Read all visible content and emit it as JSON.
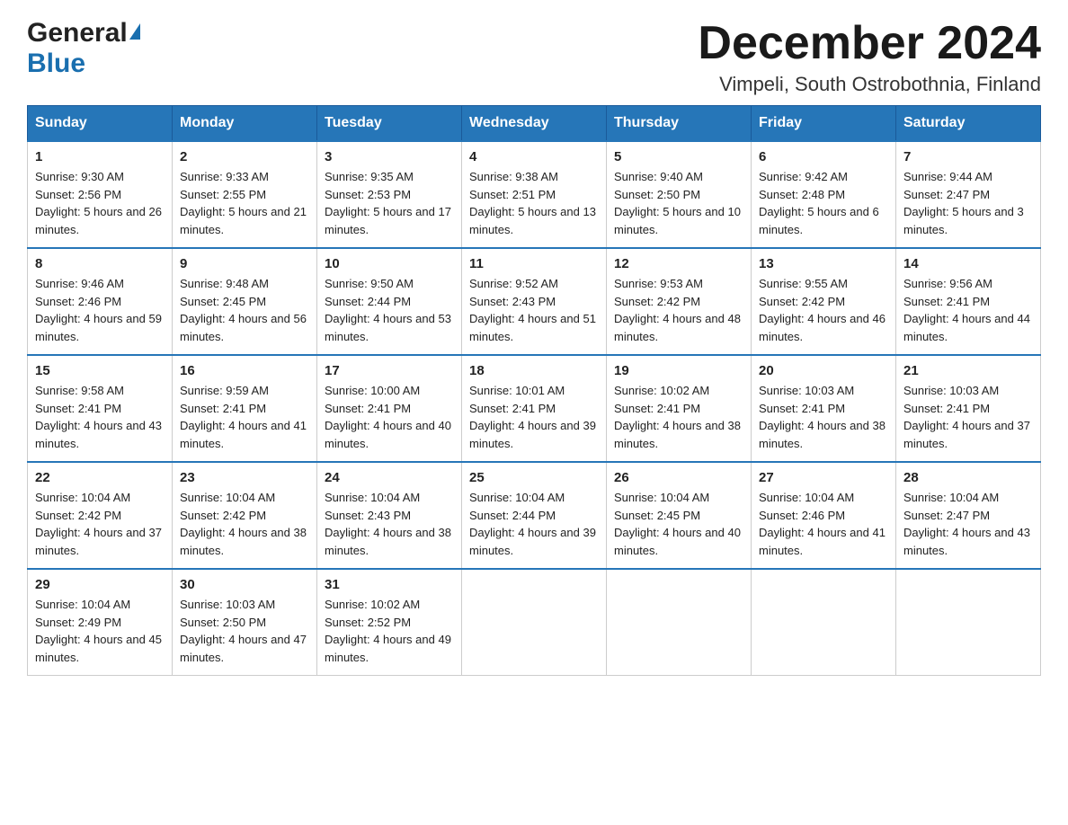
{
  "header": {
    "logo_general": "General",
    "logo_blue": "Blue",
    "month_title": "December 2024",
    "location": "Vimpeli, South Ostrobothnia, Finland"
  },
  "days_of_week": [
    "Sunday",
    "Monday",
    "Tuesday",
    "Wednesday",
    "Thursday",
    "Friday",
    "Saturday"
  ],
  "weeks": [
    [
      {
        "day": "1",
        "sunrise": "9:30 AM",
        "sunset": "2:56 PM",
        "daylight": "5 hours and 26 minutes."
      },
      {
        "day": "2",
        "sunrise": "9:33 AM",
        "sunset": "2:55 PM",
        "daylight": "5 hours and 21 minutes."
      },
      {
        "day": "3",
        "sunrise": "9:35 AM",
        "sunset": "2:53 PM",
        "daylight": "5 hours and 17 minutes."
      },
      {
        "day": "4",
        "sunrise": "9:38 AM",
        "sunset": "2:51 PM",
        "daylight": "5 hours and 13 minutes."
      },
      {
        "day": "5",
        "sunrise": "9:40 AM",
        "sunset": "2:50 PM",
        "daylight": "5 hours and 10 minutes."
      },
      {
        "day": "6",
        "sunrise": "9:42 AM",
        "sunset": "2:48 PM",
        "daylight": "5 hours and 6 minutes."
      },
      {
        "day": "7",
        "sunrise": "9:44 AM",
        "sunset": "2:47 PM",
        "daylight": "5 hours and 3 minutes."
      }
    ],
    [
      {
        "day": "8",
        "sunrise": "9:46 AM",
        "sunset": "2:46 PM",
        "daylight": "4 hours and 59 minutes."
      },
      {
        "day": "9",
        "sunrise": "9:48 AM",
        "sunset": "2:45 PM",
        "daylight": "4 hours and 56 minutes."
      },
      {
        "day": "10",
        "sunrise": "9:50 AM",
        "sunset": "2:44 PM",
        "daylight": "4 hours and 53 minutes."
      },
      {
        "day": "11",
        "sunrise": "9:52 AM",
        "sunset": "2:43 PM",
        "daylight": "4 hours and 51 minutes."
      },
      {
        "day": "12",
        "sunrise": "9:53 AM",
        "sunset": "2:42 PM",
        "daylight": "4 hours and 48 minutes."
      },
      {
        "day": "13",
        "sunrise": "9:55 AM",
        "sunset": "2:42 PM",
        "daylight": "4 hours and 46 minutes."
      },
      {
        "day": "14",
        "sunrise": "9:56 AM",
        "sunset": "2:41 PM",
        "daylight": "4 hours and 44 minutes."
      }
    ],
    [
      {
        "day": "15",
        "sunrise": "9:58 AM",
        "sunset": "2:41 PM",
        "daylight": "4 hours and 43 minutes."
      },
      {
        "day": "16",
        "sunrise": "9:59 AM",
        "sunset": "2:41 PM",
        "daylight": "4 hours and 41 minutes."
      },
      {
        "day": "17",
        "sunrise": "10:00 AM",
        "sunset": "2:41 PM",
        "daylight": "4 hours and 40 minutes."
      },
      {
        "day": "18",
        "sunrise": "10:01 AM",
        "sunset": "2:41 PM",
        "daylight": "4 hours and 39 minutes."
      },
      {
        "day": "19",
        "sunrise": "10:02 AM",
        "sunset": "2:41 PM",
        "daylight": "4 hours and 38 minutes."
      },
      {
        "day": "20",
        "sunrise": "10:03 AM",
        "sunset": "2:41 PM",
        "daylight": "4 hours and 38 minutes."
      },
      {
        "day": "21",
        "sunrise": "10:03 AM",
        "sunset": "2:41 PM",
        "daylight": "4 hours and 37 minutes."
      }
    ],
    [
      {
        "day": "22",
        "sunrise": "10:04 AM",
        "sunset": "2:42 PM",
        "daylight": "4 hours and 37 minutes."
      },
      {
        "day": "23",
        "sunrise": "10:04 AM",
        "sunset": "2:42 PM",
        "daylight": "4 hours and 38 minutes."
      },
      {
        "day": "24",
        "sunrise": "10:04 AM",
        "sunset": "2:43 PM",
        "daylight": "4 hours and 38 minutes."
      },
      {
        "day": "25",
        "sunrise": "10:04 AM",
        "sunset": "2:44 PM",
        "daylight": "4 hours and 39 minutes."
      },
      {
        "day": "26",
        "sunrise": "10:04 AM",
        "sunset": "2:45 PM",
        "daylight": "4 hours and 40 minutes."
      },
      {
        "day": "27",
        "sunrise": "10:04 AM",
        "sunset": "2:46 PM",
        "daylight": "4 hours and 41 minutes."
      },
      {
        "day": "28",
        "sunrise": "10:04 AM",
        "sunset": "2:47 PM",
        "daylight": "4 hours and 43 minutes."
      }
    ],
    [
      {
        "day": "29",
        "sunrise": "10:04 AM",
        "sunset": "2:49 PM",
        "daylight": "4 hours and 45 minutes."
      },
      {
        "day": "30",
        "sunrise": "10:03 AM",
        "sunset": "2:50 PM",
        "daylight": "4 hours and 47 minutes."
      },
      {
        "day": "31",
        "sunrise": "10:02 AM",
        "sunset": "2:52 PM",
        "daylight": "4 hours and 49 minutes."
      },
      null,
      null,
      null,
      null
    ]
  ]
}
